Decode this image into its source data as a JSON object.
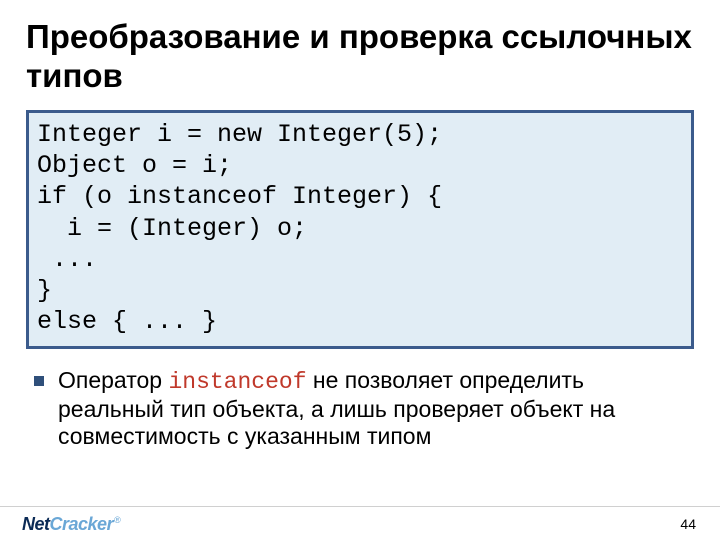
{
  "title": "Преобразование и проверка ссылочных типов",
  "code": "Integer i = new Integer(5);\nObject o = i;\nif (o instanceof Integer) {\n  i = (Integer) o;\n ...\n}\nelse { ... }",
  "bullet_pre": "Оператор ",
  "bullet_kw": "instanceof",
  "bullet_post": " не позволяет определить реальный тип объекта, а лишь проверяет объект на совместимость с указанным типом",
  "logo_part1": "Net",
  "logo_part2": "Cracker",
  "logo_reg": "®",
  "page_number": "44"
}
